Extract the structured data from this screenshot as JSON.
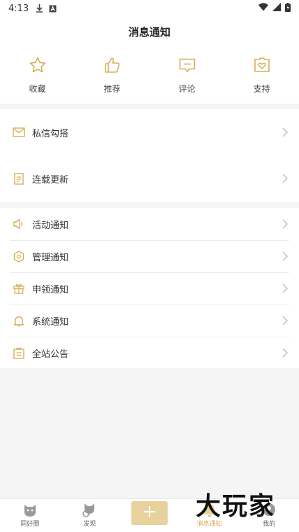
{
  "status_bar": {
    "time": "4:13"
  },
  "header": {
    "title": "消息通知"
  },
  "quick_actions": [
    {
      "label": "收藏",
      "icon": "star-icon"
    },
    {
      "label": "推荐",
      "icon": "thumbs-up-icon"
    },
    {
      "label": "评论",
      "icon": "comment-icon"
    },
    {
      "label": "支持",
      "icon": "support-heart-icon"
    }
  ],
  "group1": [
    {
      "label": "私信勾搭",
      "icon": "mail-icon"
    },
    {
      "label": "连载更新",
      "icon": "document-icon"
    }
  ],
  "group2": [
    {
      "label": "活动通知",
      "icon": "speaker-icon"
    },
    {
      "label": "管理通知",
      "icon": "hexagon-icon"
    },
    {
      "label": "申领通知",
      "icon": "gift-icon"
    },
    {
      "label": "系统通知",
      "icon": "bell-icon"
    },
    {
      "label": "全站公告",
      "icon": "announcement-icon"
    }
  ],
  "tabbar": {
    "tabs": [
      {
        "label": "同好圈",
        "icon": "cat-icon"
      },
      {
        "label": "发现",
        "icon": "discover-icon"
      },
      {
        "label": "",
        "icon": "plus-icon"
      },
      {
        "label": "消息通知",
        "icon": "bell-tab-icon",
        "active": true
      },
      {
        "label": "我的",
        "icon": "profile-icon"
      }
    ]
  },
  "watermark": {
    "text": "大玩家"
  },
  "colors": {
    "accent": "#d8ad55",
    "accent_light": "#e8d29c",
    "background": "#f5f5f5"
  }
}
